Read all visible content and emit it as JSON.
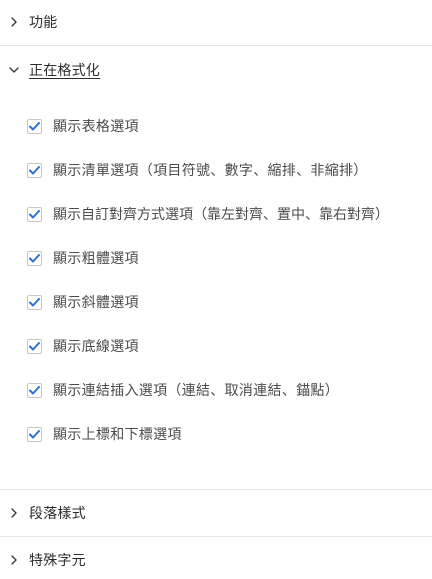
{
  "sections": {
    "features": {
      "title": "功能",
      "expanded": false
    },
    "formatting": {
      "title": "正在格式化",
      "expanded": true
    },
    "paragraph_styles": {
      "title": "段落樣式",
      "expanded": false
    },
    "special_chars": {
      "title": "特殊字元",
      "expanded": false
    }
  },
  "formatting_options": [
    {
      "label": "顯示表格選項",
      "checked": true
    },
    {
      "label": "顯示清單選項（項目符號、數字、縮排、非縮排）",
      "checked": true
    },
    {
      "label": "顯示自訂對齊方式選項（靠左對齊、置中、靠右對齊）",
      "checked": true
    },
    {
      "label": "顯示粗體選項",
      "checked": true
    },
    {
      "label": "顯示斜體選項",
      "checked": true
    },
    {
      "label": "顯示底線選項",
      "checked": true
    },
    {
      "label": "顯示連結插入選項（連結、取消連結、錨點）",
      "checked": true
    },
    {
      "label": "顯示上標和下標選項",
      "checked": true
    }
  ],
  "colors": {
    "checkmark": "#2e6fd8",
    "text": "#2c2c2c",
    "divider": "#e6e6e6"
  },
  "icons": {
    "collapsed": "chevron-right-icon",
    "expanded": "chevron-down-icon",
    "checked": "check-icon"
  }
}
